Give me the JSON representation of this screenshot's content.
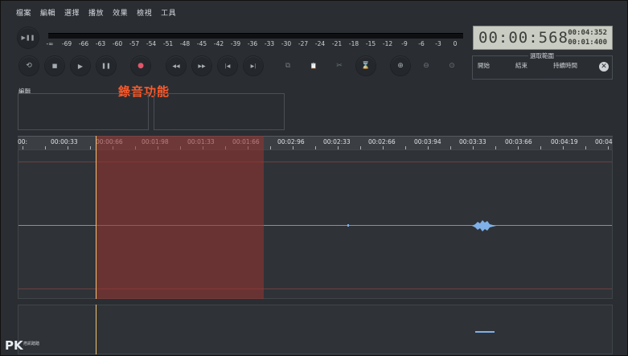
{
  "menu": [
    "檔案",
    "編輯",
    "選擇",
    "播放",
    "效果",
    "檢視",
    "工具"
  ],
  "meter": {
    "ticks": [
      "-∞",
      "-69",
      "-66",
      "-63",
      "-60",
      "-57",
      "-54",
      "-51",
      "-48",
      "-45",
      "-42",
      "-39",
      "-36",
      "-33",
      "-30",
      "-27",
      "-24",
      "-21",
      "-18",
      "-15",
      "-12",
      "-9",
      "-6",
      "-3",
      "0"
    ]
  },
  "play_pause_icon": "▶❚❚",
  "timer": {
    "main": "00:00:568",
    "sub1": "00:04:352",
    "sub2": "00:01:400"
  },
  "transport": {
    "loop": "⟲",
    "stop": "■",
    "play": "▶",
    "pause": "❚❚",
    "record": "●",
    "rewind": "◀◀",
    "forward": "▶▶",
    "skip_start": "|◀",
    "skip_end": "▶|",
    "copy": "⧉",
    "paste": "📋",
    "cut": "✂",
    "silence": "⌛",
    "zoom_in": "⊕",
    "zoom_out": "⊖",
    "zoom_fit": "⊙"
  },
  "selection_panel": {
    "title": "選取範圍",
    "start": "開始",
    "end": "結束",
    "duration": "持續時間",
    "close": "✕"
  },
  "annotation": "錄音功能",
  "box_label": "編輯",
  "ruler": [
    "00:",
    "00:00:33",
    "00:00:66",
    "00:01:98",
    "00:01:33",
    "00:01:66",
    "00:02:96",
    "00:02:33",
    "00:02:66",
    "00:03:94",
    "00:03:33",
    "00:03:66",
    "00:04:19",
    "00:04"
  ],
  "logo": {
    "mark": "PK",
    "text": "痞凱踏踏"
  },
  "colors": {
    "background": "#2a2e33",
    "selection": "#963430",
    "playhead": "#f0c070",
    "wave": "#7fb0e8",
    "record": "#e0566a",
    "annotation": "#ff5a2a"
  }
}
